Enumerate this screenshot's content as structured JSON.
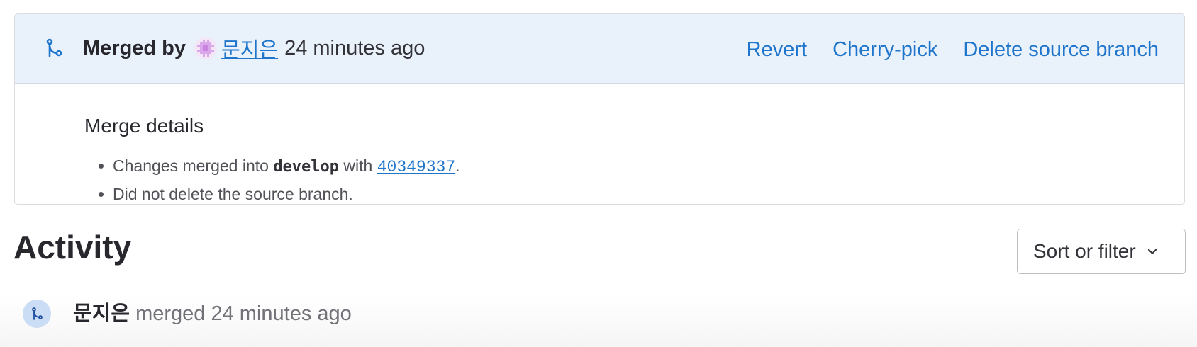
{
  "merge_widget": {
    "merged_by_label": "Merged by",
    "user_name": "문지은",
    "time": "24 minutes ago",
    "actions": {
      "revert": "Revert",
      "cherry_pick": "Cherry-pick",
      "delete_branch": "Delete source branch"
    },
    "details": {
      "title": "Merge details",
      "line1_prefix": "Changes merged into ",
      "branch": "develop",
      "line1_middle": " with ",
      "commit": "40349337",
      "line1_suffix": ".",
      "line2": "Did not delete the source branch."
    },
    "icon": "merge-icon",
    "accent_color": "#1f75cb",
    "header_bg": "#e9f1fb"
  },
  "activity": {
    "title": "Activity",
    "sort_button_label": "Sort or filter",
    "items": [
      {
        "user": "문지은",
        "action": "merged 24 minutes ago",
        "icon": "merge-icon"
      }
    ]
  }
}
